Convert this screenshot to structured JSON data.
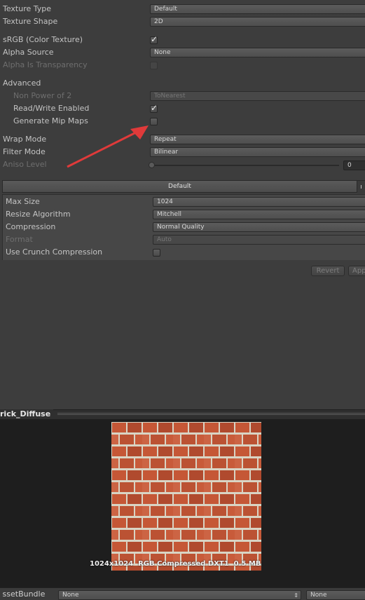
{
  "settings": {
    "texture_type": {
      "label": "Texture Type",
      "value": "Default"
    },
    "texture_shape": {
      "label": "Texture Shape",
      "value": "2D"
    },
    "srgb": {
      "label": "sRGB (Color Texture)",
      "checked": true
    },
    "alpha_source": {
      "label": "Alpha Source",
      "value": "None"
    },
    "alpha_is_transparency": {
      "label": "Alpha Is Transparency",
      "checked": false
    },
    "advanced_label": "Advanced",
    "non_power_of_2": {
      "label": "Non Power of 2",
      "value": "ToNearest"
    },
    "read_write": {
      "label": "Read/Write Enabled",
      "checked": true
    },
    "generate_mip_maps": {
      "label": "Generate Mip Maps",
      "checked": false
    },
    "wrap_mode": {
      "label": "Wrap Mode",
      "value": "Repeat"
    },
    "filter_mode": {
      "label": "Filter Mode",
      "value": "Bilinear"
    },
    "aniso_level": {
      "label": "Aniso Level",
      "value": "0"
    }
  },
  "platform": {
    "tab": "Default",
    "max_size": {
      "label": "Max Size",
      "value": "1024"
    },
    "resize_algorithm": {
      "label": "Resize Algorithm",
      "value": "Mitchell"
    },
    "compression": {
      "label": "Compression",
      "value": "Normal Quality"
    },
    "format": {
      "label": "Format",
      "value": "Auto"
    },
    "crunch": {
      "label": "Use Crunch Compression",
      "checked": false
    }
  },
  "actions": {
    "revert": "Revert",
    "apply": "App"
  },
  "preview": {
    "title": "rick_Diffuse",
    "info": "1024x1024  RGB Compressed DXT1  0.5 MB"
  },
  "assetbundle": {
    "label": "AssetBundle",
    "value": "None",
    "variant": "None"
  },
  "colors": {
    "annotation_red": "#e03a3a",
    "background": "#3d3d3d"
  }
}
